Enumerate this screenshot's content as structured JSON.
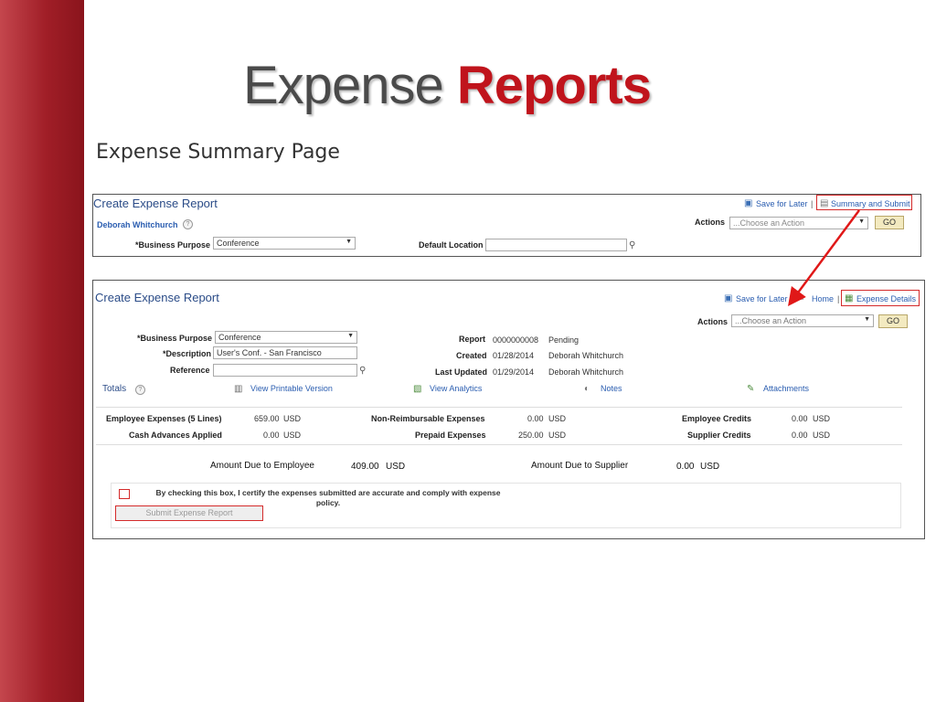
{
  "slide": {
    "title_prefix": "Expense",
    "title_accent": "Reports",
    "subtitle": "Expense Summary Page"
  },
  "top_panel": {
    "title": "Create Expense Report",
    "save_for_later": "Save for Later",
    "separator": "|",
    "summary_and_submit": "Summary and Submit",
    "user_name": "Deborah Whitchurch",
    "actions_label": "Actions",
    "actions_placeholder": "...Choose an Action",
    "go_label": "GO",
    "business_purpose_label": "*Business Purpose",
    "business_purpose_value": "Conference",
    "default_location_label": "Default Location",
    "default_location_value": ""
  },
  "main_panel": {
    "title": "Create Expense Report",
    "save_for_later": "Save for Later",
    "home": "Home",
    "separator": "|",
    "expense_details": "Expense Details",
    "actions_label": "Actions",
    "actions_placeholder": "...Choose an Action",
    "go_label": "GO",
    "business_purpose_label": "*Business Purpose",
    "business_purpose_value": "Conference",
    "description_label": "*Description",
    "description_value": "User's Conf. - San Francisco",
    "reference_label": "Reference",
    "reference_value": "",
    "report_label": "Report",
    "report_number": "0000000008",
    "report_status": "Pending",
    "created_label": "Created",
    "created_date": "01/28/2014",
    "created_by": "Deborah Whitchurch",
    "last_updated_label": "Last Updated",
    "last_updated_date": "01/29/2014",
    "last_updated_by": "Deborah Whitchurch",
    "totals_label": "Totals",
    "view_printable": "View Printable Version",
    "view_analytics": "View Analytics",
    "notes": "Notes",
    "attachments": "Attachments",
    "employee_expenses_label": "Employee Expenses (5 Lines)",
    "employee_expenses_value": "659.00",
    "cash_advances_label": "Cash Advances Applied",
    "cash_advances_value": "0.00",
    "non_reimbursable_label": "Non-Reimbursable Expenses",
    "non_reimbursable_value": "0.00",
    "prepaid_label": "Prepaid Expenses",
    "prepaid_value": "250.00",
    "employee_credits_label": "Employee Credits",
    "employee_credits_value": "0.00",
    "supplier_credits_label": "Supplier Credits",
    "supplier_credits_value": "0.00",
    "currency": "USD",
    "amount_due_employee_label": "Amount Due to Employee",
    "amount_due_employee_value": "409.00",
    "amount_due_supplier_label": "Amount Due to Supplier",
    "amount_due_supplier_value": "0.00",
    "certify_text_1": "By checking this box, I certify the expenses submitted are accurate and comply with expense",
    "certify_text_2": "policy.",
    "submit_label": "Submit Expense Report"
  },
  "colors": {
    "accent": "#c0141c",
    "link": "#2a5db0",
    "highlight": "#d42a2a",
    "sidebar": "#a01e27"
  }
}
